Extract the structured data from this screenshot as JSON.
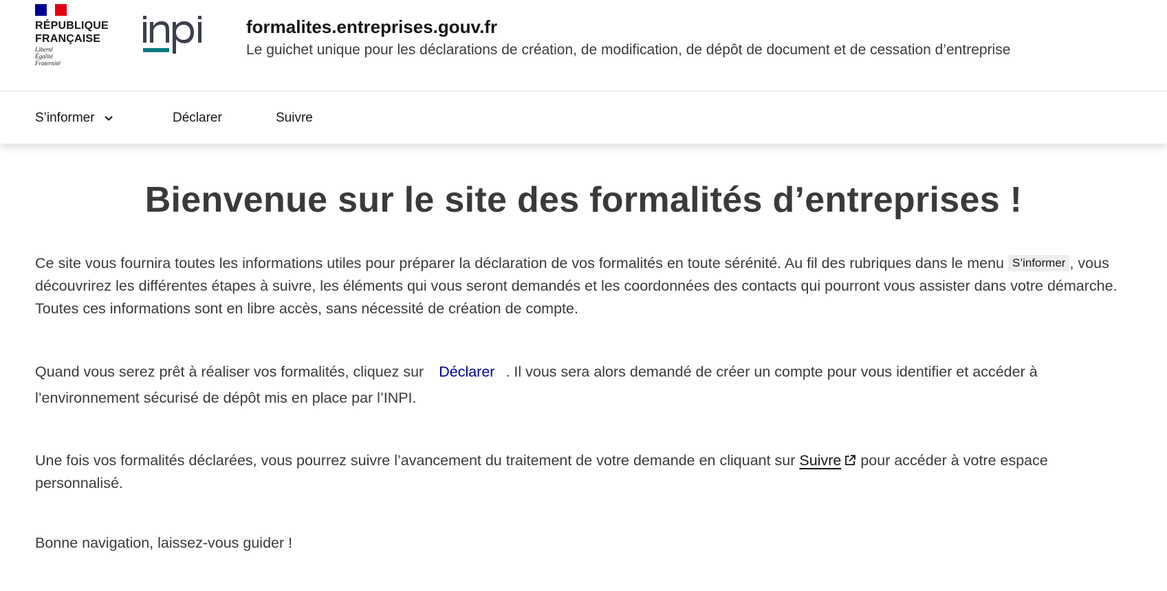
{
  "header": {
    "republic_lines": [
      "RÉPUBLIQUE",
      "FRANÇAISE"
    ],
    "motto": [
      "Liberté",
      "Égalité",
      "Fraternité"
    ],
    "logo_name": "inpi-logo",
    "site_name": "formalites.entreprises.gouv.fr",
    "tagline": "Le guichet unique pour les déclarations de création, de modification, de dépôt de document et de cessation d’entreprise",
    "colors": {
      "blue": "#000091",
      "red": "#e1000f",
      "inpi_teal": "#007a80"
    }
  },
  "nav": {
    "items": [
      {
        "label": "S’informer",
        "icon": "chevron-down-icon"
      },
      {
        "label": "Déclarer"
      },
      {
        "label": "Suivre"
      }
    ]
  },
  "main": {
    "title": "Bienvenue sur le site des formalités d’entreprises !",
    "p1": {
      "before": "Ce site vous fournira toutes les informations utiles pour préparer la déclaration de vos formalités en toute sérénité. Au fil des rubriques dans le menu ",
      "chip": "S’informer",
      "after": ", vous découvrirez les différentes étapes à suivre, les éléments qui vous seront demandés et les coordonnées des contacts qui pourront vous assister dans votre démarche. Toutes ces informations sont en libre accès, sans nécessité de création de compte."
    },
    "p2": {
      "before": "Quand vous serez prêt à réaliser vos formalités, cliquez sur",
      "link": "Déclarer",
      "after": ". Il vous sera alors demandé de créer un compte pour vous identifier et accéder à l’environnement sécurisé de dépôt mis en place par l’INPI."
    },
    "p3": {
      "before": "Une fois vos formalités déclarées, vous pourrez suivre l’avancement du traitement de votre demande en cliquant sur ",
      "link": "Suivre",
      "link_icon": "external-link-icon",
      "after": " pour accéder à votre espace personnalisé."
    },
    "p4": "Bonne navigation, laissez-vous guider !"
  }
}
